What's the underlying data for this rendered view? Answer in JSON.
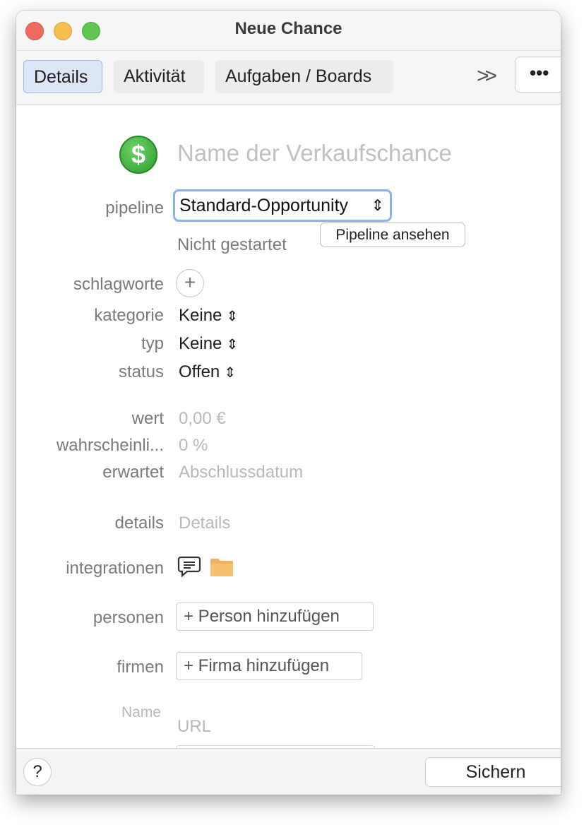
{
  "window": {
    "title": "Neue Chance"
  },
  "tabs": [
    {
      "label": "Details",
      "active": true
    },
    {
      "label": "Aktivität",
      "active": false
    },
    {
      "label": "Aufgaben / Boards",
      "active": false
    }
  ],
  "toolbar": {
    "overflow_glyph": ">>",
    "more_glyph": "•••"
  },
  "header": {
    "icon_glyph": "$",
    "name_placeholder": "Name der Verkaufschance"
  },
  "pipeline": {
    "label": "pipeline",
    "selected": "Standard-Opportunity",
    "stage": "Nicht gestartet",
    "view_button": "Pipeline ansehen"
  },
  "fields": {
    "schlagworte": {
      "label": "schlagworte"
    },
    "kategorie": {
      "label": "kategorie",
      "value": "Keine"
    },
    "typ": {
      "label": "typ",
      "value": "Keine"
    },
    "status": {
      "label": "status",
      "value": "Offen"
    },
    "wert": {
      "label": "wert",
      "placeholder": "0,00 €"
    },
    "wahrscheinlichkeit": {
      "label": "wahrscheinli...",
      "placeholder": "0 %"
    },
    "erwartet": {
      "label": "erwartet",
      "placeholder": "Abschlussdatum"
    },
    "details": {
      "label": "details",
      "placeholder": "Details"
    },
    "integrationen": {
      "label": "integrationen"
    },
    "personen": {
      "label": "personen",
      "button": "+ Person hinzufügen"
    },
    "firmen": {
      "label": "firmen",
      "button": "+ Firma hinzufügen"
    },
    "url": {
      "label": "Name",
      "placeholder": "URL"
    }
  },
  "footer": {
    "help": "?",
    "save": "Sichern"
  },
  "colors": {
    "accent_focus": "#8fb2ef",
    "active_tab_bg": "#dde6f7",
    "dollar_green": "#2c9c2e",
    "folder": "#f2b25c"
  },
  "icons": [
    "dollar-circle-icon",
    "plus-icon",
    "chat-icon",
    "folder-icon",
    "chevron-double-right-icon",
    "ellipsis-icon",
    "updown-chevron-icon"
  ]
}
